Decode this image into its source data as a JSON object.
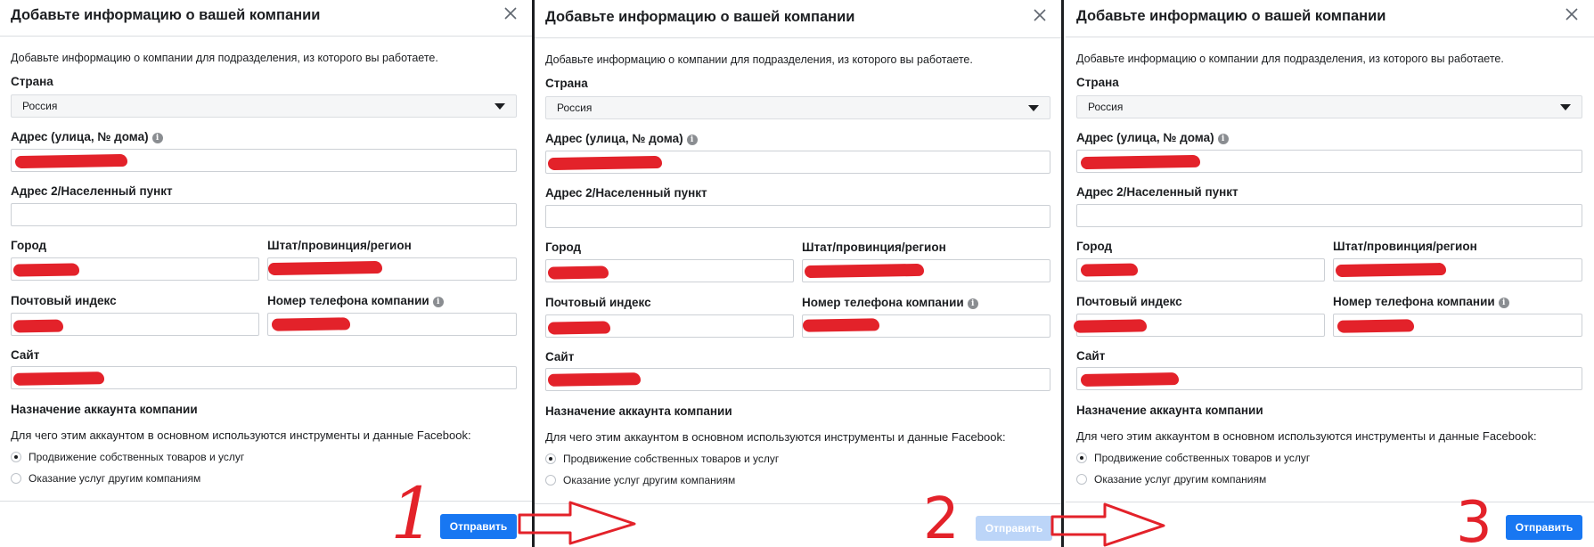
{
  "dialog": {
    "title": "Добавьте информацию о вашей компании",
    "intro": "Добавьте информацию о компании для подразделения, из которого вы работаете.",
    "country_label": "Страна",
    "country_value": "Россия",
    "address_label": "Адрес (улица, № дома)",
    "address2_label": "Адрес 2/Населенный пункт",
    "city_label": "Город",
    "state_label": "Штат/провинция/регион",
    "zip_label": "Почтовый индекс",
    "phone_label": "Номер телефона компании",
    "site_label": "Сайт",
    "purpose_label": "Назначение аккаунта компании",
    "purpose_question": "Для чего этим аккаунтом в основном используются инструменты и данные Facebook:",
    "option_1": "Продвижение собственных товаров и услуг",
    "option_2": "Оказание услуг другим компаниям",
    "submit_label": "Отправить",
    "info_icon": "info-icon",
    "close_icon": "close-icon"
  },
  "steps": [
    {
      "number": "1",
      "submit_state": "active"
    },
    {
      "number": "2",
      "submit_state": "disabled"
    },
    {
      "number": "3",
      "submit_state": "active"
    }
  ],
  "colors": {
    "accent": "#1877f2",
    "accent_disabled": "#bcd5f8",
    "annotation": "#e3222a"
  }
}
